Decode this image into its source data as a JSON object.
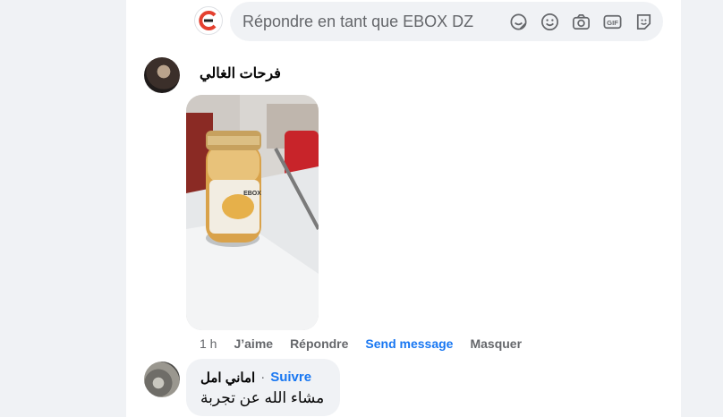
{
  "reply_bar": {
    "placeholder": "Répondre en tant que EBOX DZ",
    "icons": [
      "sticker-icon",
      "emoji-icon",
      "camera-icon",
      "gif-icon",
      "avatar-sticker-icon"
    ],
    "gif_label": "GIF"
  },
  "comments": [
    {
      "author": "فرحات الغالي",
      "time": "1 h",
      "actions": {
        "like": "J’aime",
        "reply": "Répondre",
        "send": "Send message",
        "hide": "Masquer"
      },
      "photo_label": "EBOX"
    },
    {
      "author": "اماني امل",
      "separator": "·",
      "follow": "Suivre",
      "text": "مشاء الله عن تجربة"
    }
  ],
  "colors": {
    "accent": "#1877f2",
    "muted": "#65676b",
    "bubble": "#f0f2f5",
    "page": "#f0f2f5",
    "brand": "#e4402f"
  }
}
